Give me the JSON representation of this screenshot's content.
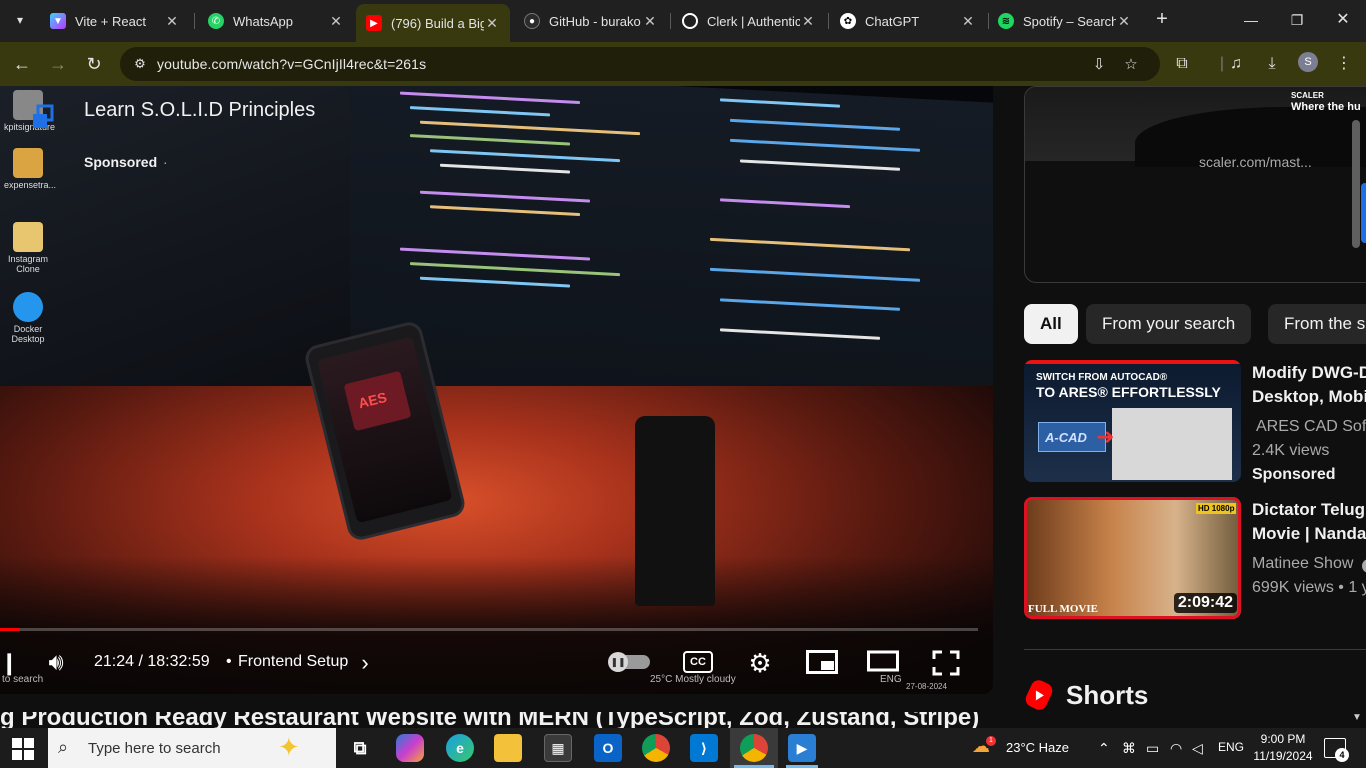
{
  "browser": {
    "tabs": [
      {
        "title": "Vite + React",
        "active": false
      },
      {
        "title": "WhatsApp",
        "active": false
      },
      {
        "title": "(796) Build a Big",
        "active": true
      },
      {
        "title": "GitHub - burako",
        "active": false
      },
      {
        "title": "Clerk | Authentic",
        "active": false
      },
      {
        "title": "ChatGPT",
        "active": false
      },
      {
        "title": "Spotify – Search",
        "active": false
      }
    ],
    "new_tab_icon": "+",
    "url": "youtube.com/watch?v=GCnIjIl4rec&t=261s",
    "profile_initial": "S"
  },
  "video": {
    "time_display": "21:24 / 18:32:59",
    "chapter": "Frontend Setup",
    "chapter_chevron": "›",
    "cc_label": "CC",
    "progress_fraction": 0.019,
    "desktop_icons": [
      {
        "label": "kpitsignature"
      },
      {
        "label": "expensetra..."
      },
      {
        "label": "Instagram Clone"
      },
      {
        "label": "Docker Desktop"
      }
    ],
    "overlay_bottom_left": "to search",
    "overlay_weather": "25°C  Mostly cloudy",
    "overlay_lang": "ENG",
    "overlay_date": "27-08-2024",
    "phone_screen_text": "AES"
  },
  "title": {
    "text": "g Production Ready Restaurant Website with MERN (TypeScript, Zod, Zustand, Stripe)"
  },
  "ad": {
    "brand": "SCALER",
    "tagline": "Where the hu",
    "title": "Learn S.O.L.I.D Principles",
    "sponsored": "Sponsored",
    "separator": "·",
    "domain": "scaler.com/mast..."
  },
  "chips": [
    {
      "label": "All",
      "selected": true
    },
    {
      "label": "From your search",
      "selected": false
    },
    {
      "label": "From the s",
      "selected": false
    }
  ],
  "recommendations": [
    {
      "title_line1": "Modify DWG-D",
      "title_line2": "Desktop, Mobi",
      "channel": "ARES CAD Softw",
      "meta": "2.4K views",
      "sponsored": "Sponsored",
      "thumb_text1": "SWITCH FROM AUTOCAD®",
      "thumb_text2": "TO ARES® EFFORTLESSLY",
      "thumb_badge": "A-CAD"
    },
    {
      "title_line1": "Dictator Telugu",
      "title_line2": "Movie | Nanda",
      "channel": "Matinee Show",
      "meta": "699K views  • 1 y",
      "duration": "2:09:42",
      "thumb_text1": "FULL MOVIE",
      "thumb_badge": "HD 1080p"
    }
  ],
  "shorts": {
    "title": "Shorts"
  },
  "taskbar": {
    "search_placeholder": "Type here to search",
    "weather": "23°C  Haze",
    "weather_alert": "1",
    "lang": "ENG",
    "time": "9:00 PM",
    "date": "11/19/2024",
    "notification_count": "4"
  },
  "colors": {
    "toolbar": "#38390f",
    "youtube_red": "#ff0000",
    "scaler_blue": "#1f6fe5"
  }
}
